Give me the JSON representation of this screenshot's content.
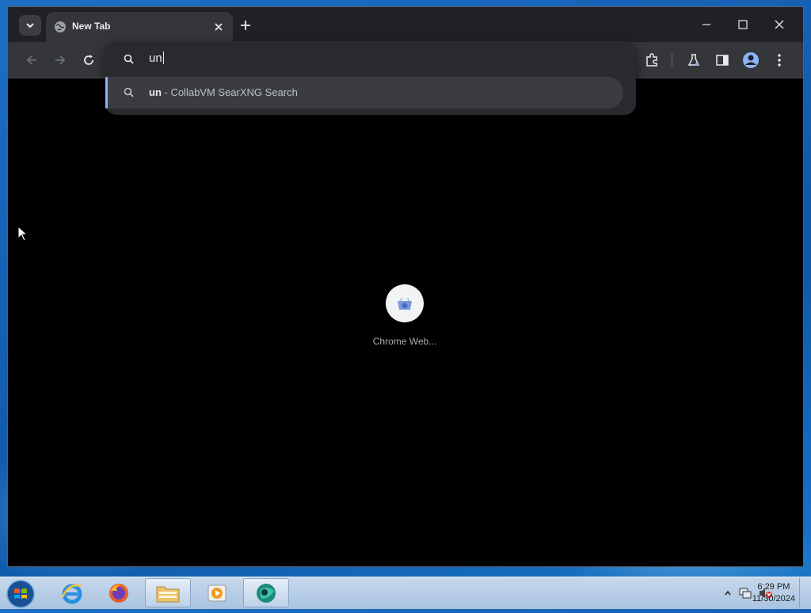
{
  "window": {
    "tab_title": "New Tab",
    "icons": {
      "tab_search": "chevron-down-icon",
      "tab_favicon": "globe-icon",
      "tab_close": "close-icon",
      "new_tab": "plus-icon",
      "minimize": "minimize-icon",
      "maximize": "maximize-icon",
      "close": "close-icon"
    }
  },
  "toolbar": {
    "icons": [
      "back-icon",
      "forward-icon",
      "reload-icon",
      "extensions-icon",
      "labs-icon",
      "side-panel-icon",
      "profile-icon",
      "menu-icon"
    ]
  },
  "omnibox": {
    "value": "un",
    "suggestion_match": "un",
    "suggestion_rest": " - CollabVM SearXNG Search"
  },
  "shortcut": {
    "label": "Chrome Web..."
  },
  "taskbar": {
    "items": [
      "start-button",
      "internet-explorer",
      "firefox",
      "file-explorer",
      "media-player",
      "chrome-app"
    ],
    "clock_time": "6:29 PM",
    "clock_date": "11/30/2024"
  },
  "colors": {
    "accent": "#8ab4f8",
    "window_bg": "#202124",
    "toolbar_bg": "#35363a",
    "content_bg": "#000000"
  }
}
